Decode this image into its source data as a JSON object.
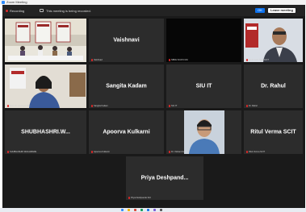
{
  "window": {
    "title": "Zoom Meeting"
  },
  "topbar": {
    "recording_label": "Recording",
    "notice": "This meeting is being recorded.",
    "ok_label": "OK",
    "leave_label": "Leave meeting"
  },
  "tiles": [
    {
      "name": "",
      "label": ""
    },
    {
      "name": "Vaishnavi",
      "label": "Vaishnavi"
    },
    {
      "name": "",
      "label": "NBFE SCLB FLNI"
    },
    {
      "name": "",
      "label": "Amjit Garit SRC SCIT"
    },
    {
      "name": "",
      "label": "Prof. Dr. Lovanya Ms..."
    },
    {
      "name": "Sangita Kadam",
      "label": "Sangita Kadam"
    },
    {
      "name": "SIU IT",
      "label": "SIU IT"
    },
    {
      "name": "Dr. Rahul",
      "label": "Dr. Rahul"
    },
    {
      "name": "SHUBHASHRI.W...",
      "label": "SHUBHASHRI.WAGHMARE"
    },
    {
      "name": "Apoorva Kulkarni",
      "label": "Apoorva Kulkarni"
    },
    {
      "name": "",
      "label": "Dr. Vishant Kar"
    },
    {
      "name": "Ritul Verma SCIT",
      "label": "Ritul Verma SCIT"
    },
    {
      "name": "Priya  Deshpand...",
      "label": "Priya Deshpande SCI"
    }
  ],
  "colors": {
    "recording": "#e02828",
    "primary_button": "#0e72ed",
    "tile_background": "#2c2c2c"
  }
}
